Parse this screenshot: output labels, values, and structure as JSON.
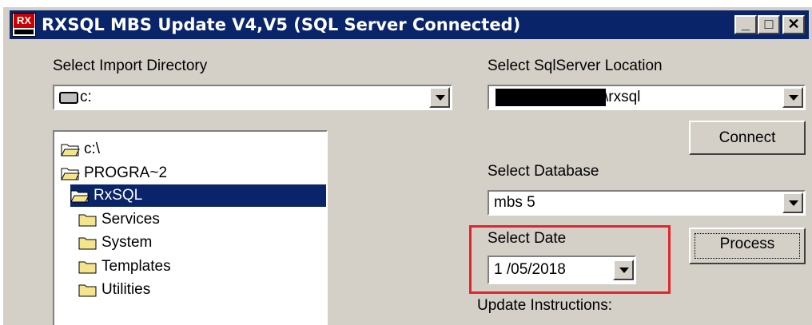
{
  "window": {
    "title": "RXSQL MBS Update V4,V5 (SQL Server Connected)",
    "icon_label": "RX",
    "controls": {
      "minimize": "_",
      "maximize": "□",
      "close": "✕"
    }
  },
  "import": {
    "directory_label": "Select Import Directory",
    "drive_value": "c:",
    "tree": [
      {
        "label": "c:\\",
        "level": 0,
        "open": true,
        "selected": false
      },
      {
        "label": "PROGRA~2",
        "level": 1,
        "open": true,
        "selected": false
      },
      {
        "label": "RxSQL",
        "level": 2,
        "open": true,
        "selected": true
      },
      {
        "label": "Services",
        "level": 3,
        "open": false,
        "selected": false
      },
      {
        "label": "System",
        "level": 3,
        "open": false,
        "selected": false
      },
      {
        "label": "Templates",
        "level": 3,
        "open": false,
        "selected": false
      },
      {
        "label": "Utilities",
        "level": 3,
        "open": false,
        "selected": false
      }
    ]
  },
  "server": {
    "location_label": "Select SqlServer Location",
    "location_value": "\\rxsql",
    "connect_label": "Connect",
    "database_label": "Select Database",
    "database_value": "mbs 5"
  },
  "date": {
    "label": "Select Date",
    "value": "1 /05/2018"
  },
  "process_label": "Process",
  "instructions_label": "Update Instructions:",
  "colors": {
    "title_bar": "#0a246a",
    "face": "#d4d0c8",
    "selection": "#0a246a",
    "highlight_box": "#e0262b",
    "folder": "#f4e48c"
  }
}
